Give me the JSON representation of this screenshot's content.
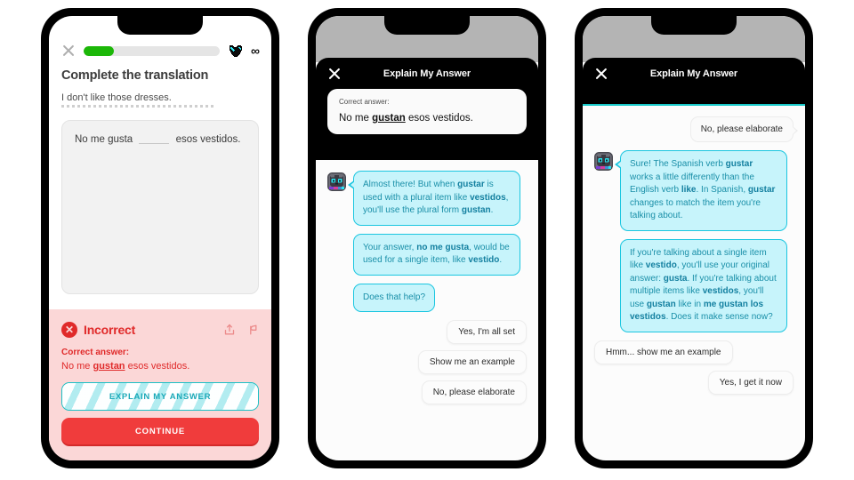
{
  "phone1": {
    "close_icon": "close-icon",
    "progress_percent": 22,
    "hearts_icon": "heart-icon",
    "hearts_value": "∞",
    "title": "Complete the translation",
    "prompt": "I don't like those dresses.",
    "answer_prefix": "No me gusta",
    "answer_suffix": "esos vestidos.",
    "result": {
      "badge_icon": "error-x-icon",
      "badge_glyph": "✕",
      "status": "Incorrect",
      "share_icon": "share-icon",
      "report_icon": "flag-icon",
      "correct_label": "Correct answer:",
      "correct_prefix": "No me ",
      "correct_bold": "gustan",
      "correct_suffix": " esos vestidos.",
      "explain_button": "EXPLAIN MY ANSWER",
      "continue_button": "CONTINUE"
    }
  },
  "phone2": {
    "close_icon": "close-icon",
    "modal_title": "Explain My Answer",
    "answer_card": {
      "label": "Correct answer:",
      "prefix": "No me ",
      "bold": "gustan",
      "suffix": " esos vestidos."
    },
    "avatar_icon": "mascot-cat-icon",
    "messages": [
      {
        "sender": "bot",
        "parts": [
          {
            "t": "Almost there! But when ",
            "b": false
          },
          {
            "t": "gustar",
            "b": true
          },
          {
            "t": " is used with a plural item like ",
            "b": false
          },
          {
            "t": "vestidos",
            "b": true
          },
          {
            "t": ", you'll use the plural form ",
            "b": false
          },
          {
            "t": "gustan",
            "b": true
          },
          {
            "t": ".",
            "b": false
          }
        ]
      },
      {
        "sender": "bot",
        "parts": [
          {
            "t": "Your answer, ",
            "b": false
          },
          {
            "t": "no me gusta",
            "b": true
          },
          {
            "t": ", would be used for a single item, like ",
            "b": false
          },
          {
            "t": "vestido",
            "b": true
          },
          {
            "t": ".",
            "b": false
          }
        ]
      },
      {
        "sender": "bot",
        "parts": [
          {
            "t": "Does that help?",
            "b": false
          }
        ]
      }
    ],
    "options": [
      {
        "label": "Yes, I'm all set",
        "align": "r"
      },
      {
        "label": "Show me an example",
        "align": "r"
      },
      {
        "label": "No, please elaborate",
        "align": "r"
      }
    ]
  },
  "phone3": {
    "close_icon": "close-icon",
    "modal_title": "Explain My Answer",
    "avatar_icon": "mascot-cat-icon",
    "user_message": "No, please elaborate",
    "messages": [
      {
        "sender": "bot",
        "parts": [
          {
            "t": "Sure! The Spanish verb ",
            "b": false
          },
          {
            "t": "gustar",
            "b": true
          },
          {
            "t": " works a little differently than the English verb ",
            "b": false
          },
          {
            "t": "like",
            "b": true
          },
          {
            "t": ". In Spanish, ",
            "b": false
          },
          {
            "t": "gustar",
            "b": true
          },
          {
            "t": " changes to match the item you're talking about.",
            "b": false
          }
        ]
      },
      {
        "sender": "bot",
        "parts": [
          {
            "t": "If you're talking about a single item like ",
            "b": false
          },
          {
            "t": "vestido",
            "b": true
          },
          {
            "t": ", you'll use your original answer: ",
            "b": false
          },
          {
            "t": "gusta",
            "b": true
          },
          {
            "t": ". If you're talking about multiple items like ",
            "b": false
          },
          {
            "t": "vestidos",
            "b": true
          },
          {
            "t": ", you'll use ",
            "b": false
          },
          {
            "t": "gustan",
            "b": true
          },
          {
            "t": " like in ",
            "b": false
          },
          {
            "t": "me gustan los vestidos",
            "b": true
          },
          {
            "t": ". Does it make sense now?",
            "b": false
          }
        ]
      }
    ],
    "options": [
      {
        "label": "Hmm... show me an example",
        "align": "l"
      },
      {
        "label": "Yes, I get it now",
        "align": "r"
      }
    ]
  },
  "colors": {
    "green_progress": "#1CB708",
    "error_red": "#E02A2A",
    "continue_red": "#F03C3C",
    "banner_pink": "#FBD7D7",
    "bubble_cyan": "#C7F4FB",
    "bubble_border": "#1BC6E0",
    "bubble_text": "#1A8FA8",
    "teal_accent": "#18C9C9"
  }
}
